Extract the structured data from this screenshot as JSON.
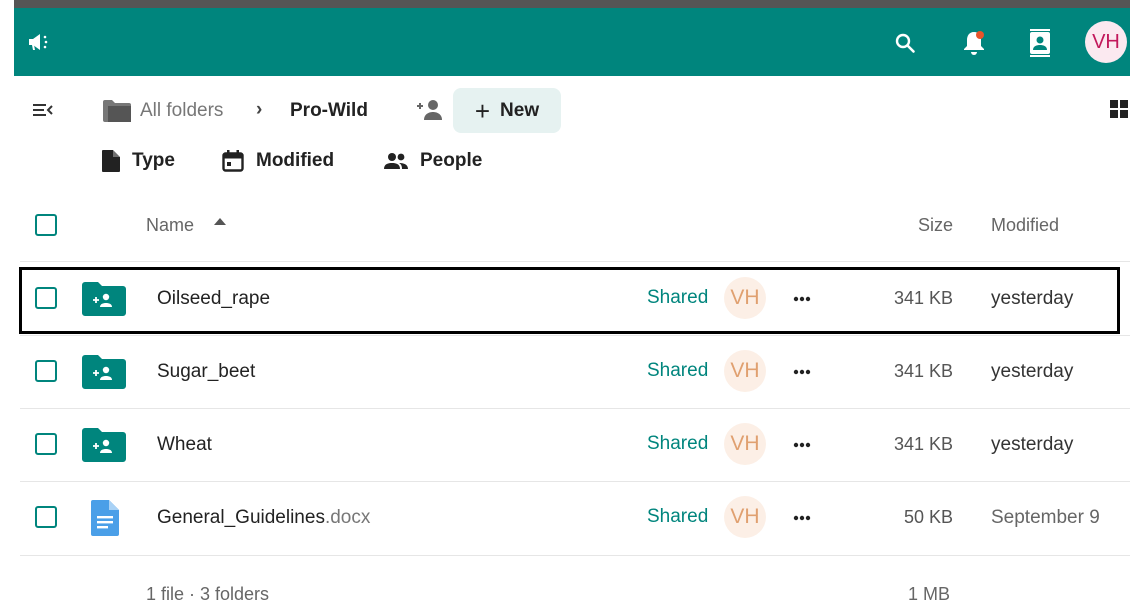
{
  "topbar": {
    "announce_icon": "megaphone-icon",
    "search_icon": "search-icon",
    "notifications_icon": "bell-icon",
    "contacts_icon": "contacts-icon",
    "avatar_initials": "VH",
    "bg_color": "#00857d"
  },
  "breadcrumb": {
    "root_label": "All folders",
    "current_label": "Pro-Wild",
    "new_label": "New"
  },
  "filters": [
    {
      "label": "Type",
      "icon": "file-icon"
    },
    {
      "label": "Modified",
      "icon": "calendar-icon"
    },
    {
      "label": "People",
      "icon": "people-icon"
    }
  ],
  "columns": {
    "name": "Name",
    "size": "Size",
    "modified": "Modified"
  },
  "files": [
    {
      "name": "Oilseed_rape",
      "ext": "",
      "type": "shared-folder",
      "shared": "Shared",
      "owner": "VH",
      "size": "341 KB",
      "modified": "yesterday"
    },
    {
      "name": "Sugar_beet",
      "ext": "",
      "type": "shared-folder",
      "shared": "Shared",
      "owner": "VH",
      "size": "341 KB",
      "modified": "yesterday"
    },
    {
      "name": "Wheat",
      "ext": "",
      "type": "shared-folder",
      "shared": "Shared",
      "owner": "VH",
      "size": "341 KB",
      "modified": "yesterday"
    },
    {
      "name": "General_Guidelines",
      "ext": ".docx",
      "type": "document",
      "shared": "Shared",
      "owner": "VH",
      "size": "50 KB",
      "modified": "September 9"
    }
  ],
  "summary": {
    "count_label": "1 file · 3 folders",
    "total_size": "1 MB"
  }
}
